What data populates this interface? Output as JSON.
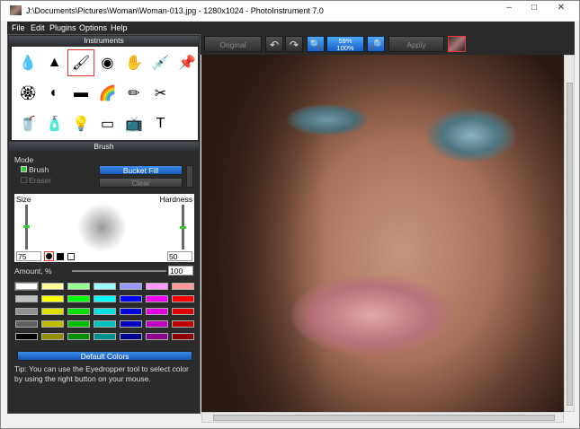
{
  "window": {
    "title": "J:\\Documents\\Pictures\\Woman\\Woman-013.jpg - 1280x1024 - PhotoInstrument 7.0",
    "minimize": "–",
    "maximize": "□",
    "close": "✕"
  },
  "menu": [
    "File",
    "Edit",
    "Plugins",
    "Options",
    "Help"
  ],
  "instruments": {
    "header": "Instruments",
    "icons": [
      "drop-icon",
      "cone-icon",
      "brushes-icon",
      "stamp-icon",
      "finger-icon",
      "dropper-white-icon",
      "pin-icon",
      "badge-icon",
      "eye-icon",
      "gradient-icon",
      "rainbow-icon",
      "pencils-icon",
      "scissors-icon",
      "empty",
      "cup-icon",
      "bottle-icon",
      "bulb-icon",
      "eraser-icon",
      "tv-icon",
      "text-icon",
      "empty"
    ],
    "glyphs": [
      "💧",
      "▲",
      "🖌",
      "◉",
      "✋",
      "💉",
      "📌",
      "🏵",
      "◐",
      "▬",
      "🌈",
      "✏",
      "✂",
      "",
      "🥤",
      "🧴",
      "💡",
      "▭",
      "📺",
      "T",
      ""
    ]
  },
  "brush": {
    "header": "Brush",
    "mode_label": "Mode",
    "brush_option": "Brush",
    "eraser_option": "Eraser",
    "bucket_fill": "Bucket Fill",
    "clear": "Clear",
    "size_label": "Size",
    "hardness_label": "Hardness",
    "size_value": "75",
    "hardness_value": "50",
    "amount_label": "Amount, %",
    "amount_value": "100",
    "default_colors": "Default Colors",
    "tip": "Tip: You can use the Eyedropper tool to select color by using the right button on your mouse.",
    "size_fraction": 0.5,
    "hardness_fraction": 0.5,
    "amount_fraction": 1.0
  },
  "palette": [
    [
      "#ffffff",
      "#ffff99",
      "#99ff99",
      "#99ffff",
      "#9999ff",
      "#ff99ff",
      "#ff9999"
    ],
    [
      "#c0c0c0",
      "#ffff00",
      "#00ff00",
      "#00ffff",
      "#0000ff",
      "#ff00ff",
      "#ff0000"
    ],
    [
      "#909090",
      "#e0e000",
      "#00e000",
      "#00e0e0",
      "#0000e0",
      "#e000e0",
      "#e00000"
    ],
    [
      "#606060",
      "#c0c000",
      "#00c000",
      "#00c0c0",
      "#0000c0",
      "#c000c0",
      "#c00000"
    ],
    [
      "#000000",
      "#909000",
      "#009000",
      "#009090",
      "#000090",
      "#900090",
      "#900000"
    ]
  ],
  "toolbar": {
    "original": "Original",
    "apply": "Apply",
    "zoom_top": "59%",
    "zoom_bottom": "100%"
  }
}
